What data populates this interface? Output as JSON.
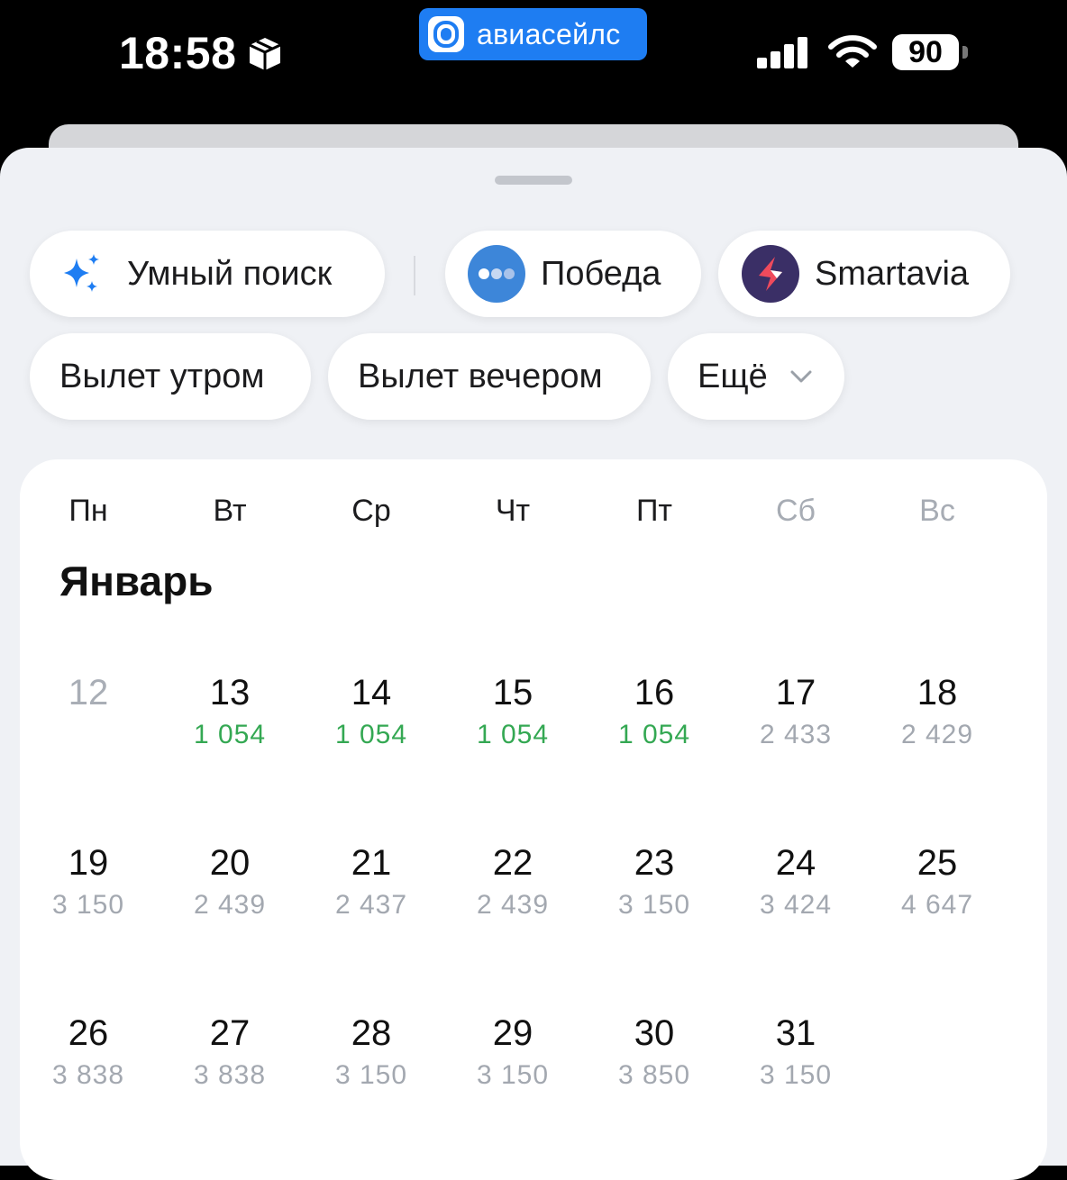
{
  "status_bar": {
    "time": "18:58",
    "app_name": "авиасейлс",
    "battery": "90",
    "colors": {
      "app_pill": "#1e7df2"
    }
  },
  "filters": {
    "smart_search": "Умный поиск",
    "pobeda": "Победа",
    "smartavia": "Smartavia",
    "morning": "Вылет утром",
    "evening": "Вылет вечером",
    "more": "Ещё"
  },
  "calendar": {
    "weekdays": [
      "Пн",
      "Вт",
      "Ср",
      "Чт",
      "Пт",
      "Сб",
      "Вс"
    ],
    "month": "Январь",
    "weeks": [
      [
        {
          "day": "12",
          "price": ""
        },
        {
          "day": "13",
          "price": "1 054"
        },
        {
          "day": "14",
          "price": "1 054"
        },
        {
          "day": "15",
          "price": "1 054"
        },
        {
          "day": "16",
          "price": "1 054"
        },
        {
          "day": "17",
          "price": "2 433"
        },
        {
          "day": "18",
          "price": "2 429"
        }
      ],
      [
        {
          "day": "19",
          "price": "3 150"
        },
        {
          "day": "20",
          "price": "2 439"
        },
        {
          "day": "21",
          "price": "2 437"
        },
        {
          "day": "22",
          "price": "2 439"
        },
        {
          "day": "23",
          "price": "3 150"
        },
        {
          "day": "24",
          "price": "3 424"
        },
        {
          "day": "25",
          "price": "4 647"
        }
      ],
      [
        {
          "day": "26",
          "price": "3 838"
        },
        {
          "day": "27",
          "price": "3 838"
        },
        {
          "day": "28",
          "price": "3 150"
        },
        {
          "day": "29",
          "price": "3 150"
        },
        {
          "day": "30",
          "price": "3 850"
        },
        {
          "day": "31",
          "price": "3 150"
        }
      ]
    ],
    "colors": {
      "cheap_price": "#34a853",
      "regular_price": "#a3a8b0"
    }
  }
}
